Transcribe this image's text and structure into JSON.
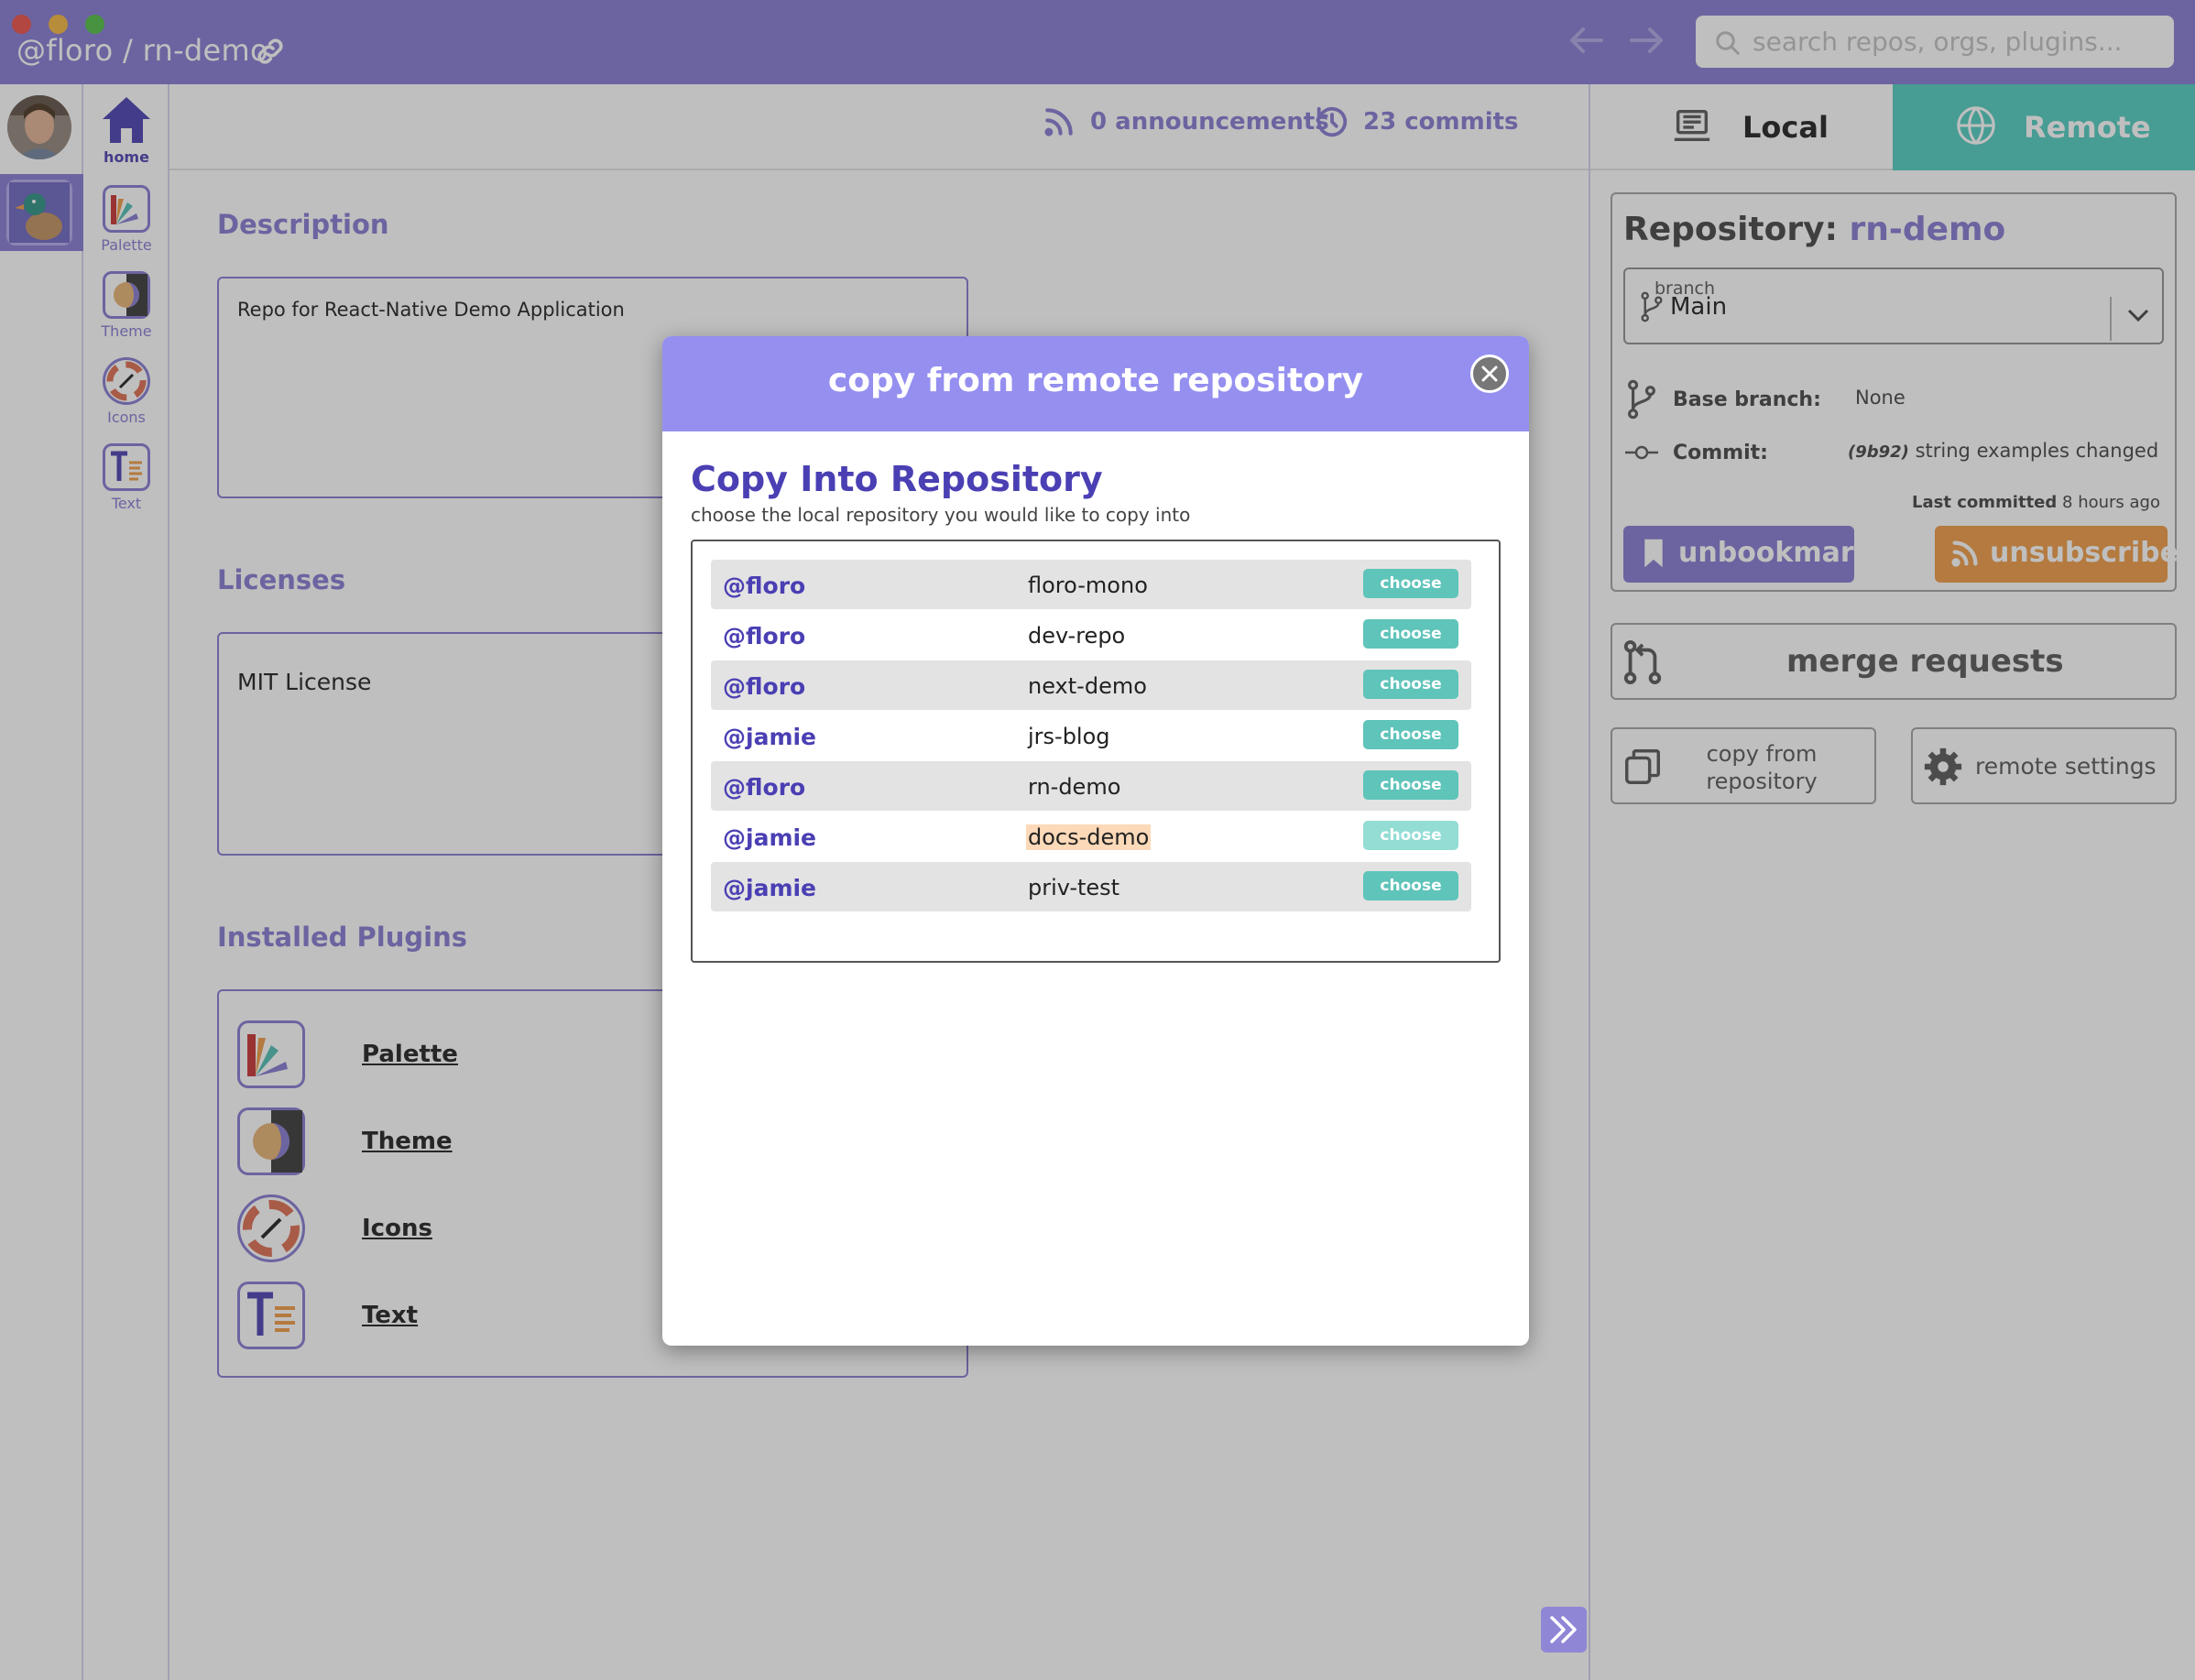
{
  "titlebar": {
    "breadcrumb": "@floro / rn-demo",
    "search_placeholder": "search repos, orgs, plugins..."
  },
  "rail": {
    "home_label": "home",
    "plugins": [
      {
        "label": "Palette",
        "icon": "palette-icon"
      },
      {
        "label": "Theme",
        "icon": "theme-icon"
      },
      {
        "label": "Icons",
        "icon": "icons-icon"
      },
      {
        "label": "Text",
        "icon": "text-icon"
      }
    ]
  },
  "main": {
    "announcements": "0 announcements",
    "commits": "23 commits",
    "description_title": "Description",
    "description_text": "Repo for React-Native Demo Application",
    "licenses_title": "Licenses",
    "license_text": "MIT License",
    "plugins_title": "Installed Plugins",
    "installed_plugins": [
      "Palette",
      "Theme",
      "Icons",
      "Text"
    ]
  },
  "right_panel": {
    "tab_local": "Local",
    "tab_remote": "Remote",
    "repo_label": "Repository:",
    "repo_name": "rn-demo",
    "branch_legend": "branch",
    "branch_value": "Main",
    "base_branch_label": "Base branch:",
    "base_branch_value": "None",
    "commit_label": "Commit:",
    "commit_sha": "(9b92)",
    "commit_message": "string examples changed",
    "last_committed_label": "Last committed",
    "last_committed_time": "8 hours ago",
    "unbookmark": "unbookmark",
    "unsubscribe": "unsubscribe",
    "merge_requests": "merge requests",
    "copy_from_repository": "copy from repository",
    "remote_settings": "remote settings"
  },
  "modal": {
    "title": "copy from remote repository",
    "heading": "Copy Into Repository",
    "subtitle": "choose the local repository you would like to copy into",
    "choose_label": "choose",
    "repos": [
      {
        "owner": "@floro",
        "name": "floro-mono"
      },
      {
        "owner": "@floro",
        "name": "dev-repo"
      },
      {
        "owner": "@floro",
        "name": "next-demo"
      },
      {
        "owner": "@jamie",
        "name": "jrs-blog"
      },
      {
        "owner": "@floro",
        "name": "rn-demo"
      },
      {
        "owner": "@jamie",
        "name": "docs-demo"
      },
      {
        "owner": "@jamie",
        "name": "priv-test"
      }
    ]
  },
  "colors": {
    "brand_purple": "#8f86d6",
    "modal_header": "#958ff0",
    "remote_teal": "#5fd0c4",
    "unsubscribe_orange": "#f0a355",
    "choose_teal": "#5fc4ba"
  }
}
